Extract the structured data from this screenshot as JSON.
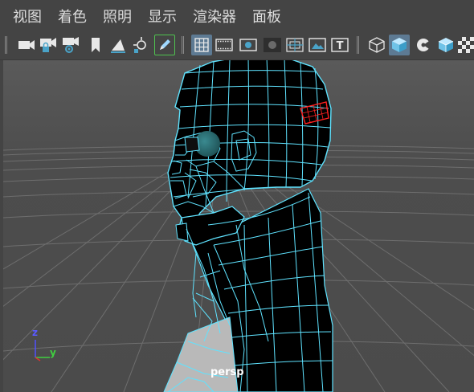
{
  "menu": {
    "items": [
      "视图",
      "着色",
      "照明",
      "显示",
      "渲染器",
      "面板"
    ]
  },
  "toolbar": {
    "icons": [
      "camera-icon",
      "camera-lock-icon",
      "camera-attributes-icon",
      "bookmark-icon",
      "image-plane-icon",
      "pan-zoom-icon",
      "grease-pencil-icon",
      "grid-icon",
      "film-gate-icon",
      "resolution-gate-icon",
      "gate-mask-icon",
      "field-chart-icon",
      "safe-action-icon",
      "safe-title-icon",
      "wireframe-icon",
      "smooth-shade-icon",
      "default-material-icon",
      "textured-icon",
      "xray-icon"
    ],
    "active": [
      "grease-pencil-icon",
      "grid-icon",
      "smooth-shade-icon"
    ]
  },
  "viewport": {
    "camera_label": "persp",
    "axis": {
      "z": "z",
      "y": "y"
    },
    "colors": {
      "background": "#4a4a4a",
      "grid": "#6e6e6e",
      "mesh_fill": "#000000",
      "wireframe": "#5fe3ff",
      "selection": "#ff2020",
      "eye": "#2a6e73"
    }
  }
}
